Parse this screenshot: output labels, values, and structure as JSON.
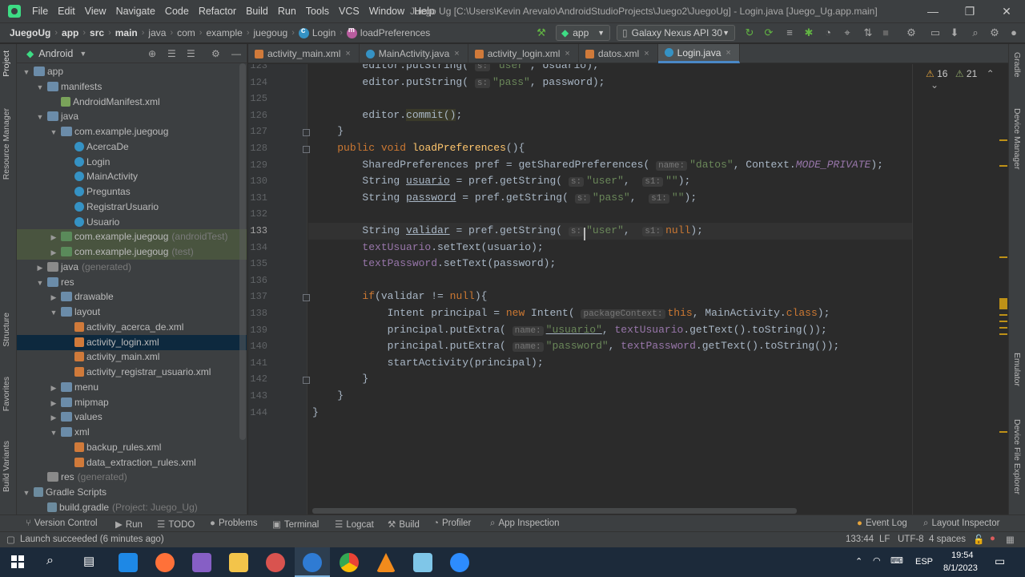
{
  "window": {
    "title": "Juego Ug [C:\\Users\\Kevin Arevalo\\AndroidStudioProjects\\Juego2\\JuegoUg] - Login.java [Juego_Ug.app.main]",
    "menu": [
      "File",
      "Edit",
      "View",
      "Navigate",
      "Code",
      "Refactor",
      "Build",
      "Run",
      "Tools",
      "VCS",
      "Window",
      "Help"
    ],
    "controls": {
      "minimize": "—",
      "maximize": "❐",
      "close": "✕"
    }
  },
  "breadcrumb": [
    "JuegoUg",
    "app",
    "src",
    "main",
    "java",
    "com",
    "example",
    "juegoug",
    "Login",
    "loadPreferences"
  ],
  "toolbar": {
    "run_config": "app",
    "device": "Galaxy Nexus API 30"
  },
  "project_panel": {
    "view_label": "Android",
    "rows": [
      {
        "label": "app",
        "extra": "",
        "icon": "folder",
        "depth": 0,
        "arrow": "down"
      },
      {
        "label": "manifests",
        "extra": "",
        "icon": "folder",
        "depth": 1,
        "arrow": "down"
      },
      {
        "label": "AndroidManifest.xml",
        "extra": "",
        "icon": "manifest",
        "depth": 2,
        "arrow": ""
      },
      {
        "label": "java",
        "extra": "",
        "icon": "folder",
        "depth": 1,
        "arrow": "down"
      },
      {
        "label": "com.example.juegoug",
        "extra": "",
        "icon": "folder-pkg",
        "depth": 2,
        "arrow": "down"
      },
      {
        "label": "AcercaDe",
        "extra": "",
        "icon": "cls",
        "depth": 3,
        "arrow": ""
      },
      {
        "label": "Login",
        "extra": "",
        "icon": "cls",
        "depth": 3,
        "arrow": ""
      },
      {
        "label": "MainActivity",
        "extra": "",
        "icon": "cls",
        "depth": 3,
        "arrow": ""
      },
      {
        "label": "Preguntas",
        "extra": "",
        "icon": "cls",
        "depth": 3,
        "arrow": ""
      },
      {
        "label": "RegistrarUsuario",
        "extra": "",
        "icon": "cls",
        "depth": 3,
        "arrow": ""
      },
      {
        "label": "Usuario",
        "extra": "",
        "icon": "cls",
        "depth": 3,
        "arrow": ""
      },
      {
        "label": "com.example.juegoug",
        "extra": "(androidTest)",
        "icon": "folder-test",
        "depth": 2,
        "arrow": "right",
        "highlight": true
      },
      {
        "label": "com.example.juegoug",
        "extra": "(test)",
        "icon": "folder-test",
        "depth": 2,
        "arrow": "right",
        "highlight": true
      },
      {
        "label": "java",
        "extra": "(generated)",
        "icon": "folder-gen",
        "depth": 1,
        "arrow": "right"
      },
      {
        "label": "res",
        "extra": "",
        "icon": "folder",
        "depth": 1,
        "arrow": "down"
      },
      {
        "label": "drawable",
        "extra": "",
        "icon": "folder",
        "depth": 2,
        "arrow": "right"
      },
      {
        "label": "layout",
        "extra": "",
        "icon": "folder",
        "depth": 2,
        "arrow": "down"
      },
      {
        "label": "activity_acerca_de.xml",
        "extra": "",
        "icon": "xml",
        "depth": 3,
        "arrow": ""
      },
      {
        "label": "activity_login.xml",
        "extra": "",
        "icon": "xml",
        "depth": 3,
        "arrow": "",
        "selected": true
      },
      {
        "label": "activity_main.xml",
        "extra": "",
        "icon": "xml",
        "depth": 3,
        "arrow": ""
      },
      {
        "label": "activity_registrar_usuario.xml",
        "extra": "",
        "icon": "xml",
        "depth": 3,
        "arrow": ""
      },
      {
        "label": "menu",
        "extra": "",
        "icon": "folder",
        "depth": 2,
        "arrow": "right"
      },
      {
        "label": "mipmap",
        "extra": "",
        "icon": "folder",
        "depth": 2,
        "arrow": "right"
      },
      {
        "label": "values",
        "extra": "",
        "icon": "folder",
        "depth": 2,
        "arrow": "right"
      },
      {
        "label": "xml",
        "extra": "",
        "icon": "folder",
        "depth": 2,
        "arrow": "down"
      },
      {
        "label": "backup_rules.xml",
        "extra": "",
        "icon": "xml",
        "depth": 3,
        "arrow": ""
      },
      {
        "label": "data_extraction_rules.xml",
        "extra": "",
        "icon": "xml",
        "depth": 3,
        "arrow": ""
      },
      {
        "label": "res",
        "extra": "(generated)",
        "icon": "folder-gen",
        "depth": 1,
        "arrow": ""
      },
      {
        "label": "Gradle Scripts",
        "extra": "",
        "icon": "gradle",
        "depth": 0,
        "arrow": "down"
      },
      {
        "label": "build.gradle",
        "extra": "(Project: Juego_Ug)",
        "icon": "gradle",
        "depth": 1,
        "arrow": ""
      }
    ]
  },
  "left_stripe": [
    "Project",
    "Resource Manager",
    "Structure",
    "Favorites",
    "Build Variants"
  ],
  "right_stripe": [
    "Gradle",
    "Device Manager",
    "Emulator",
    "Device File Explorer"
  ],
  "tabs": [
    {
      "label": "activity_main.xml",
      "type": "xml",
      "active": false
    },
    {
      "label": "MainActivity.java",
      "type": "java",
      "active": false
    },
    {
      "label": "activity_login.xml",
      "type": "xml",
      "active": false
    },
    {
      "label": "datos.xml",
      "type": "xml",
      "active": false
    },
    {
      "label": "Login.java",
      "type": "java",
      "active": true
    }
  ],
  "inspection": {
    "warnings": "16",
    "weak_warnings": "21"
  },
  "editor": {
    "current_line": 133,
    "lines": [
      {
        "n": 123,
        "html": "        editor.putString( <span class='hint'>s:</span><span class='str'>\"user\"</span>, Usuario);"
      },
      {
        "n": 124,
        "html": "        editor.putString( <span class='hint'>s:</span><span class='str'>\"pass\"</span>, password);"
      },
      {
        "n": 125,
        "html": ""
      },
      {
        "n": 126,
        "html": "        editor.<span class='warn-bg'>commit()</span>;"
      },
      {
        "n": 127,
        "html": "    }"
      },
      {
        "n": 128,
        "html": "    <span class='kw'>public void</span> <span class='fn'>loadPreferences</span>(){"
      },
      {
        "n": 129,
        "html": "        SharedPreferences pref = getSharedPreferences( <span class='hint'>name:</span><span class='str'>\"datos\"</span>, Context.<span class='fld ital'>MODE_PRIVATE</span>);"
      },
      {
        "n": 130,
        "html": "        String <span class='ul'>usuario</span> = pref.getString( <span class='hint'>s:</span><span class='str'>\"user\"</span>,  <span class='hint'>s1:</span><span class='str'>\"\"</span>);"
      },
      {
        "n": 131,
        "html": "        String <span class='ul'>password</span> = pref.getString( <span class='hint'>s:</span><span class='str'>\"pass\"</span>,  <span class='hint'>s1:</span><span class='str'>\"\"</span>);"
      },
      {
        "n": 132,
        "html": ""
      },
      {
        "n": 133,
        "html": "        String <span class='ul'>validar</span> = pref.getString( <span class='hint'>s:</span><span class='str'>\"user\"</span>,  <span class='hint'>s1:</span><span class='kw'>null</span>);"
      },
      {
        "n": 134,
        "html": "        <span class='fld'>textUsuario</span>.setText(usuario);"
      },
      {
        "n": 135,
        "html": "        <span class='fld'>textPassword</span>.setText(password);"
      },
      {
        "n": 136,
        "html": ""
      },
      {
        "n": 137,
        "html": "        <span class='kw'>if</span>(validar != <span class='kw'>null</span>){"
      },
      {
        "n": 138,
        "html": "            Intent principal = <span class='kw'>new</span> Intent( <span class='hint'>packageContext:</span><span class='kw'>this</span>, MainActivity.<span class='kw'>class</span>);"
      },
      {
        "n": 139,
        "html": "            principal.putExtra( <span class='hint'>name:</span><span class='str ul'>\"usuario\"</span>, <span class='fld'>textUsuario</span>.getText().toString());"
      },
      {
        "n": 140,
        "html": "            principal.putExtra( <span class='hint'>name:</span><span class='str'>\"password\"</span>, <span class='fld'>textPassword</span>.getText().toString());"
      },
      {
        "n": 141,
        "html": "            startActivity(principal);"
      },
      {
        "n": 142,
        "html": "        }"
      },
      {
        "n": 143,
        "html": "    }"
      },
      {
        "n": 144,
        "html": "}"
      }
    ]
  },
  "tool_windows": [
    "Version Control",
    "Run",
    "TODO",
    "Problems",
    "Terminal",
    "Logcat",
    "Build",
    "Profiler",
    "App Inspection",
    "Event Log",
    "Layout Inspector"
  ],
  "status": {
    "message": "Launch succeeded (6 minutes ago)",
    "position": "133:44",
    "line_sep": "LF",
    "encoding": "UTF-8",
    "indent": "4 spaces"
  },
  "taskbar": {
    "lang": "ESP",
    "time": "19:54",
    "date": "8/1/2023"
  }
}
